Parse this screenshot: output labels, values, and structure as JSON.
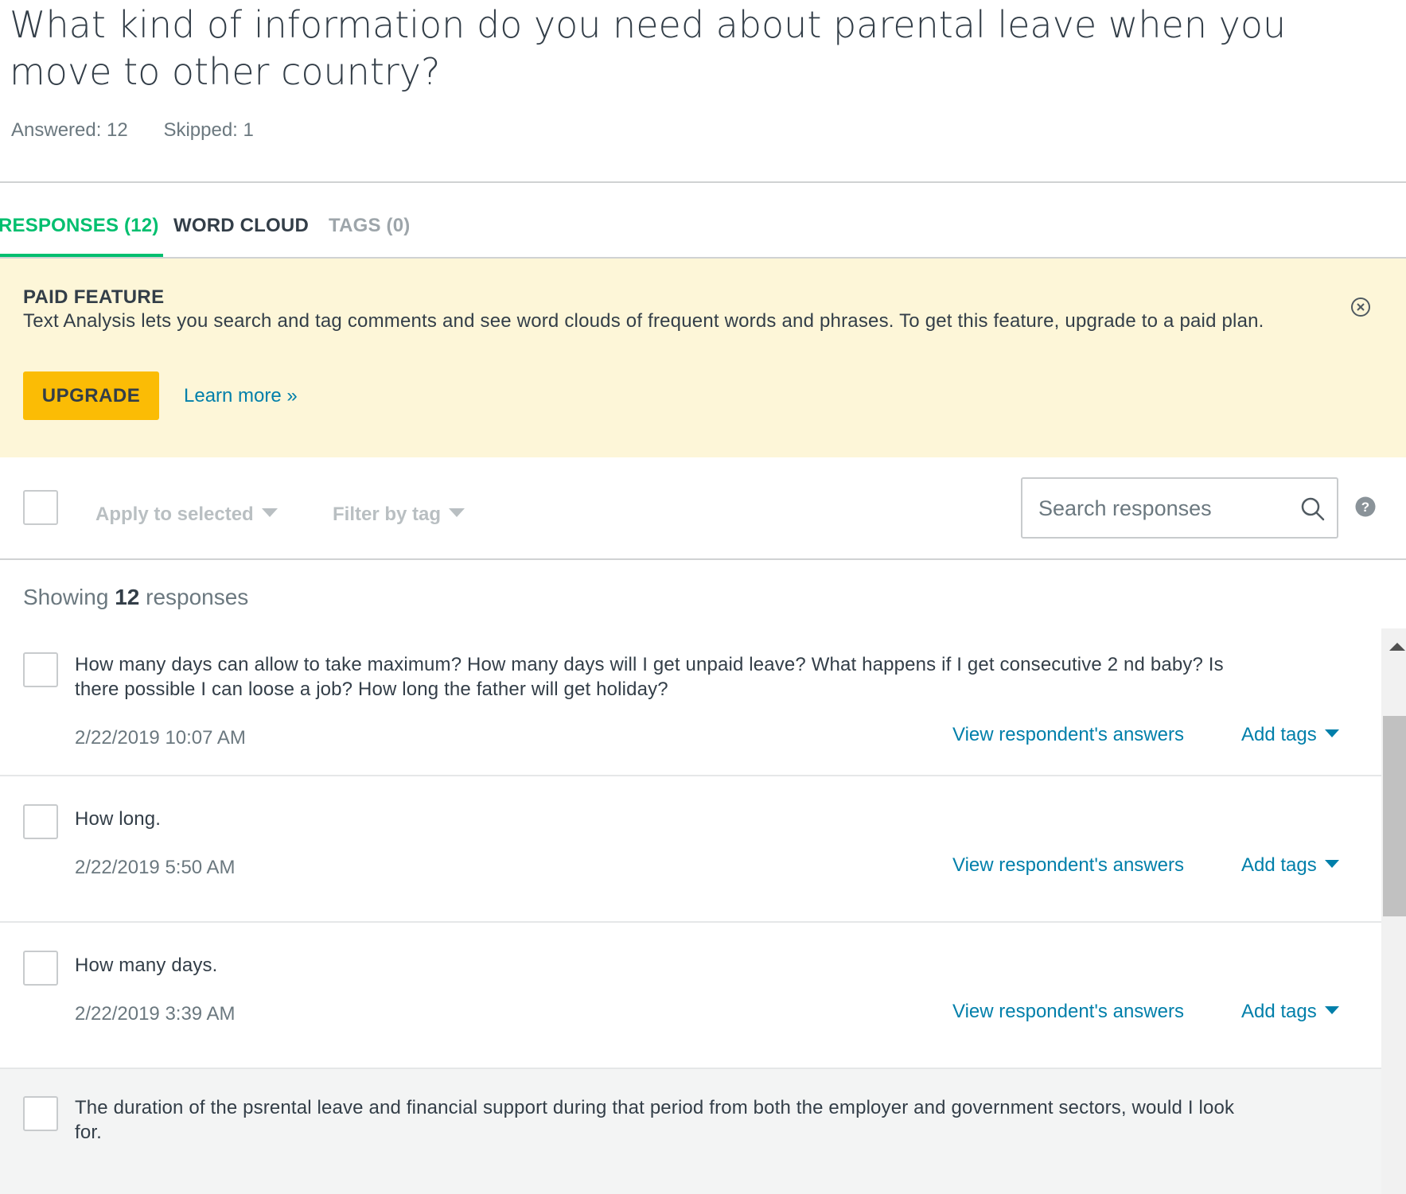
{
  "question": {
    "title": "What kind of information do you need about parental leave when you move to other country?",
    "answered": "Answered: 12",
    "skipped": "Skipped: 1"
  },
  "tabs": [
    {
      "label": "RESPONSES (12)",
      "active": true
    },
    {
      "label": "WORD CLOUD",
      "active": false
    },
    {
      "label": "TAGS (0)",
      "active": false
    }
  ],
  "paid_banner": {
    "title": "PAID FEATURE",
    "text": "Text Analysis lets you search and tag comments and see word clouds of frequent words and phrases. To get this feature, upgrade to a paid plan.",
    "upgrade_label": "UPGRADE",
    "learn_more_label": "Learn more »",
    "close_icon": "close-circle-icon",
    "background_color": "#fdf6d8",
    "button_color": "#fbbc05"
  },
  "toolbar": {
    "apply_label": "Apply to selected",
    "filter_label": "Filter by tag",
    "search_placeholder": "Search responses",
    "search_icon": "search-icon",
    "help_icon": "help-icon"
  },
  "showing": {
    "prefix": "Showing",
    "count": "12",
    "suffix": "responses"
  },
  "responses": [
    {
      "text": "How many days can allow to take maximum? How many days will I get unpaid leave? What happens if I get consecutive 2 nd baby? Is there possible I can loose a job? How long the father will get holiday?",
      "date": "2/22/2019 10:07 AM",
      "view_label": "View respondent's answers",
      "tags_label": "Add tags"
    },
    {
      "text": "How long.",
      "date": "2/22/2019 5:50 AM",
      "view_label": "View respondent's answers",
      "tags_label": "Add tags"
    },
    {
      "text": "How many days.",
      "date": "2/22/2019 3:39 AM",
      "view_label": "View respondent's answers",
      "tags_label": "Add tags"
    },
    {
      "text": "The duration of the psrental leave and financial support during that period from both the employer and government sectors, would I look for.",
      "date": "",
      "view_label": "",
      "tags_label": ""
    }
  ],
  "colors": {
    "accent_green": "#00bf6f",
    "link_blue": "#007faa",
    "text_dark": "#333e48",
    "text_muted": "#6b787f",
    "hover_row": "#f3f4f4"
  }
}
